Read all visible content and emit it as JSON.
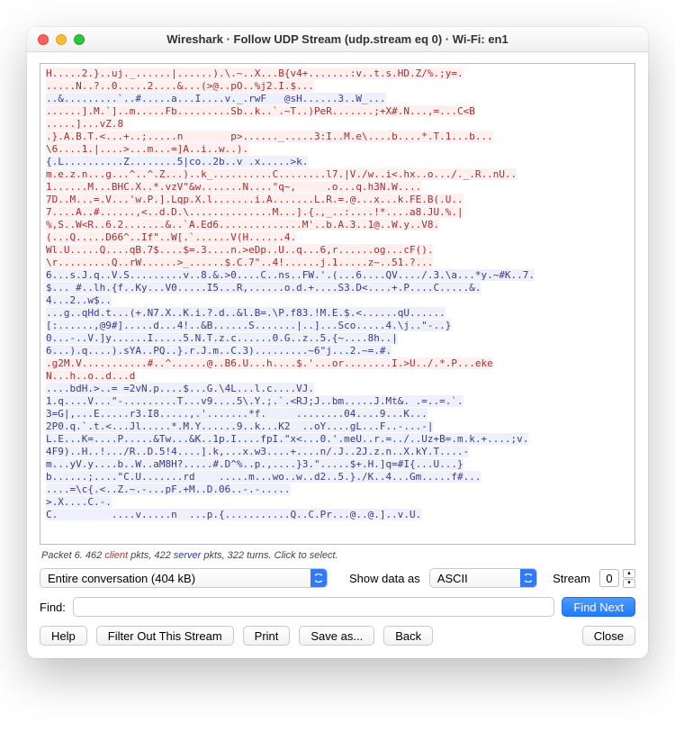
{
  "window": {
    "title": "Wireshark · Follow UDP Stream (udp.stream eq 0) · Wi-Fi: en1"
  },
  "status": {
    "prefix": "Packet 6. 462 ",
    "client_word": "client",
    "mid1": " pkts, 422 ",
    "server_word": "server",
    "suffix": " pkts, 322 turns. Click to select."
  },
  "controls": {
    "conversation_selected": "Entire conversation (404 kB)",
    "show_as_label": "Show data as",
    "show_as_selected": "ASCII",
    "stream_label": "Stream",
    "stream_value": "0",
    "find_label": "Find:",
    "find_value": "",
    "find_next": "Find Next"
  },
  "buttons": {
    "help": "Help",
    "filter_out": "Filter Out This Stream",
    "print": "Print",
    "save_as": "Save as...",
    "back": "Back",
    "close": "Close"
  },
  "stream": [
    {
      "k": "c",
      "t": "H.....2.}..uj._......|......).\\.~..X...B{v4+.......:v..t.s.HD.Z/%.;y=."
    },
    {
      "k": "c",
      "t": ".....N..?..0.....2....&...(>@..pO..%j2.I.$..."
    },
    {
      "k": "s",
      "t": "..&.........`..#.....a...I....v._.rwF   @sH......3..W_..."
    },
    {
      "k": "c",
      "t": "......].M.`]..m.....Fb.........Sb..k..`.~T..)PeR.......;+X#.N...,=...C<B"
    },
    {
      "k": "c",
      "t": ".....]...vZ.8"
    },
    {
      "k": "c",
      "t": ".}.A.B.T.<...+..;.....n        p>......_.....3:I..M.e\\....b....*.T.1...b..."
    },
    {
      "k": "c",
      "t": "\\6....1.|....>...m...=]A..i..w..)."
    },
    {
      "k": "s",
      "t": "{.L..........Z........5|co..2b..v .x.....>k."
    },
    {
      "k": "c",
      "t": "m.e.z.n...g...^..^.Z...)..k_..........C........l7.|V./w..i<.hx..o.../._.R..nU.."
    },
    {
      "k": "c",
      "t": "1......M...BHC.X..*.vzV\"&w.......N....\"q~,     .o...q.h3N.W...."
    },
    {
      "k": "c",
      "t": "7D..M...=.V...'w.P.].Lqp.X.l.......i.A.......L.R.=.@...x...k.FE.B(.U.."
    },
    {
      "k": "c",
      "t": "7....A..#......,<..d.D.\\..............M...].{.,_..:....!*....a8.JU.%.|"
    },
    {
      "k": "c",
      "t": "%,S..W<R..6.2.......&..`A.Ed6..............M'..b.A.3..1@..W.y..V8."
    },
    {
      "k": "c",
      "t": "(...Q.....D66^..If\"..W[.`......V(H......4."
    },
    {
      "k": "c",
      "t": "Wl.U.....Q....qB.7$....$=.3....n.>eDp..U..q...6,r......og...cF()."
    },
    {
      "k": "c",
      "t": "\\r.........Q..rW......>_......$.C.7\"..4!......j.1.....z~..51.?..."
    },
    {
      "k": "s",
      "t": "6...s.J.q..V.S.........v..8.&.>0....C..ns..FW.'.(...6....QV..../.3.\\a...*y.~#K..7."
    },
    {
      "k": "s",
      "t": "$... #..lh.{f..Ky...V0.....I5...R,......o.d.+....S3.D<....+.P....C.....&."
    },
    {
      "k": "s",
      "t": "4...2..w$.."
    },
    {
      "k": "s",
      "t": "...g..qHd.t...(+.N7.X..K.i.?.d..&l.B=.\\P.f83.!M.E.$.<......qU......"
    },
    {
      "k": "s",
      "t": "[:......,@9#].....d...4!..&B......S.......|..]...Sco.....4.\\j..\"-..}"
    },
    {
      "k": "s",
      "t": "0...-..V.]y......I.....5.N.T.z.c......0.G..z..5.{~....8h..|"
    },
    {
      "k": "s",
      "t": "6...).q....).sYA..PQ..}.r.J.m..C.3).........~6\"j...2.~=.#."
    },
    {
      "k": "c",
      "t": ".g2M.V...........#..^......@..B6.U...h....$.'...or........I.>U../.*.P...eke"
    },
    {
      "k": "c",
      "t": "N...h..o..d...d"
    },
    {
      "k": "s",
      "t": "....bdH.>..= =2vN.p....$...G.\\4L...l.c....VJ."
    },
    {
      "k": "s",
      "t": "1.q....V...\"-.........T...v9....5\\.Y.;.`.<RJ;J..bm.....J.Mt&. .=..=.`."
    },
    {
      "k": "s",
      "t": "3=G|,...E.....r3.I8.....,.'.......*f.     ........04....9...K..."
    },
    {
      "k": "s",
      "t": "2P0.q.`.t.<...Jl.....*.M.Y......9..k...K2  ..oY....gL...F..-...-|"
    },
    {
      "k": "s",
      "t": "L.E...K=....P.....&Tw...&K..1p.I....fpI.\"x<...0.'.meU..r.=../..Uz+B=.m.k.+....;v."
    },
    {
      "k": "s",
      "t": "4F9)..H..!.../R..D.5!4....].k,...x.w3....+....n/.J..2J.z.n..X.kY.T....-"
    },
    {
      "k": "s",
      "t": "m...yV.y....b..W..aM8H?.....#.D^%..p.,....}3.\".....$+.H.]q=#I{...U...}"
    },
    {
      "k": "s",
      "t": "b......;....\"C.U.......rd    .....m...wo..w..d2..5.}./K..4...Gm.....f#..."
    },
    {
      "k": "s",
      "t": "....=\\c{.<..Z.~.-...pF.+M..D.06..-.-....."
    },
    {
      "k": "s",
      "t": ">.X....C.-."
    },
    {
      "k": "s",
      "t": "C.         ....v.....n  ...p.{...........Q..C.Pr...@..@.]..v.U."
    }
  ]
}
